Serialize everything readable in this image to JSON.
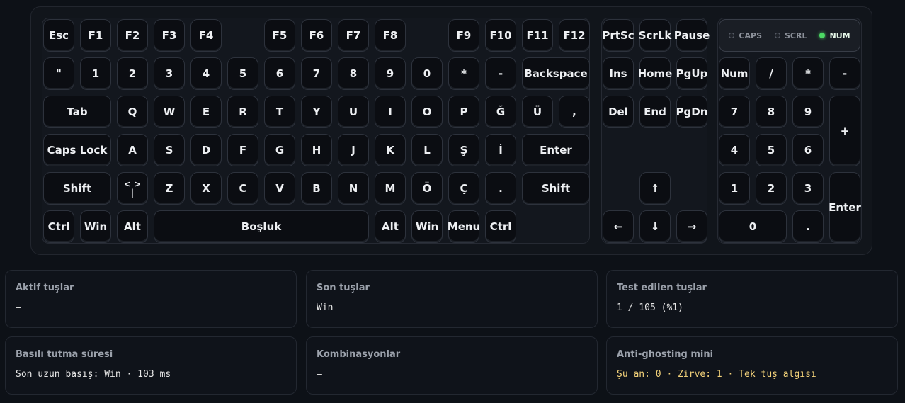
{
  "keys": {
    "esc": "Esc",
    "f1": "F1",
    "f2": "F2",
    "f3": "F3",
    "f4": "F4",
    "f5": "F5",
    "f6": "F6",
    "f7": "F7",
    "f8": "F8",
    "f9": "F9",
    "f10": "F10",
    "f11": "F11",
    "f12": "F12",
    "quote": "\"",
    "n1": "1",
    "n2": "2",
    "n3": "3",
    "n4": "4",
    "n5": "5",
    "n6": "6",
    "n7": "7",
    "n8": "8",
    "n9": "9",
    "n0": "0",
    "star": "*",
    "minus": "-",
    "backspace": "Backspace",
    "tab": "Tab",
    "q": "Q",
    "w": "W",
    "e": "E",
    "r": "R",
    "t": "T",
    "y": "Y",
    "u": "U",
    "i": "I",
    "o": "O",
    "p": "P",
    "gbreve": "Ğ",
    "uuml": "Ü",
    "comma": ",",
    "capslock": "Caps Lock",
    "a": "A",
    "s": "S",
    "d": "D",
    "f": "F",
    "g": "G",
    "h": "H",
    "j": "J",
    "k": "K",
    "l": "L",
    "scedil": "Ş",
    "idot": "İ",
    "enter": "Enter",
    "lshift": "Shift",
    "angle_top": "< >",
    "angle_bottom": "|",
    "z": "Z",
    "x": "X",
    "c": "C",
    "v": "V",
    "b": "B",
    "n": "N",
    "m": "M",
    "oum": "Ö",
    "ccedil": "Ç",
    "period": ".",
    "rshift": "Shift",
    "lctrl": "Ctrl",
    "lwin": "Win",
    "lalt": "Alt",
    "space": "Boşluk",
    "ralt": "Alt",
    "rwin": "Win",
    "menu": "Menu",
    "rctrl": "Ctrl",
    "prtsc": "PrtSc",
    "scrlk": "ScrLk",
    "pause": "Pause",
    "ins": "Ins",
    "home": "Home",
    "pgup": "PgUp",
    "del": "Del",
    "end": "End",
    "pgdn": "PgDn",
    "up": "↑",
    "left": "←",
    "down": "↓",
    "right": "→",
    "num": "Num",
    "np_slash": "/",
    "np_star": "*",
    "np_minus": "-",
    "np7": "7",
    "np8": "8",
    "np9": "9",
    "np_plus": "+",
    "np4": "4",
    "np5": "5",
    "np6": "6",
    "np1": "1",
    "np2": "2",
    "np3": "3",
    "np_enter": "Enter",
    "np0": "0",
    "np_dot": "."
  },
  "leds": {
    "caps": "CAPS",
    "scrl": "SCRL",
    "num": "NUM"
  },
  "led_states": {
    "caps": false,
    "scrl": false,
    "num": true
  },
  "panels": {
    "active": {
      "title": "Aktif tuşlar",
      "value": "—"
    },
    "last": {
      "title": "Son tuşlar",
      "value": "Win"
    },
    "tested": {
      "title": "Test edilen tuşlar",
      "value": "1 / 105 (%1)"
    },
    "hold": {
      "title": "Basılı tutma süresi",
      "value": "Son uzun basış: Win · 103 ms"
    },
    "combos": {
      "title": "Kombinasyonlar",
      "value": "—"
    },
    "ghost": {
      "title": "Anti-ghosting mini",
      "value": "Şu an: 0 · Zirve: 1 · Tek tuş algısı"
    }
  },
  "colors": {
    "led_on": "#4cd964",
    "highlight_value": "#f3d27a",
    "background": "#0d1117"
  }
}
